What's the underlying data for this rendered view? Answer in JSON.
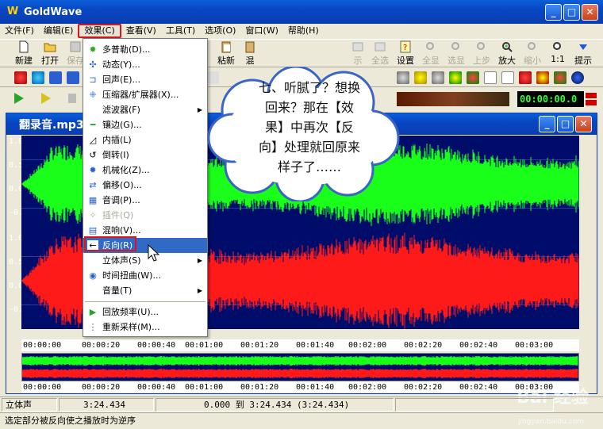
{
  "window": {
    "title": "GoldWave",
    "icon": "W"
  },
  "menubar": [
    "文件(F)",
    "编辑(E)",
    "效果(C)",
    "查看(V)",
    "工具(T)",
    "选项(O)",
    "窗口(W)",
    "帮助(H)"
  ],
  "toolbar1": {
    "new": "新建",
    "open": "打开",
    "save": "保存",
    "paste_new": "粘新",
    "mix": "混",
    "show": "示",
    "select_all": "全选",
    "settings": "设置",
    "all": "全显",
    "selection": "选显",
    "prev": "上步",
    "zoom_in": "放大",
    "zoom_out": "缩小",
    "ratio": "1:1",
    "hint": "提示"
  },
  "time_display": "00:00:00.0",
  "document": {
    "title": "翻录音.mp3"
  },
  "y_labels": [
    "1.0",
    "0.5",
    "0.0",
    "-0.5",
    "1.0",
    "0.5",
    "0.0",
    "-0.5"
  ],
  "ruler_labels": [
    "00:00:00",
    "00:00:20",
    "00:00:40",
    "00:01:00",
    "00:01:20",
    "00:01:40",
    "00:02:00",
    "00:02:20",
    "00:02:40",
    "00:03:00"
  ],
  "effects_menu": [
    {
      "label": "多普勒(D)...",
      "icon": "doppler-icon",
      "disabled": false,
      "submenu": false
    },
    {
      "label": "动态(Y)...",
      "icon": "dynamics-icon",
      "disabled": false,
      "submenu": false
    },
    {
      "label": "回声(E)...",
      "icon": "echo-icon",
      "disabled": false,
      "submenu": false
    },
    {
      "label": "压缩器/扩展器(X)...",
      "icon": "compressor-icon",
      "disabled": false,
      "submenu": false
    },
    {
      "label": "滤波器(F)",
      "icon": "",
      "disabled": false,
      "submenu": true
    },
    {
      "label": "镶边(G)...",
      "icon": "flanger-icon",
      "disabled": false,
      "submenu": false
    },
    {
      "label": "内插(L)",
      "icon": "interpolate-icon",
      "disabled": false,
      "submenu": false
    },
    {
      "label": "倒转(I)",
      "icon": "invert-icon",
      "disabled": false,
      "submenu": false
    },
    {
      "label": "机械化(Z)...",
      "icon": "mechanize-icon",
      "disabled": false,
      "submenu": false
    },
    {
      "label": "偏移(O)...",
      "icon": "offset-icon",
      "disabled": false,
      "submenu": false
    },
    {
      "label": "音调(P)...",
      "icon": "pitch-icon",
      "disabled": false,
      "submenu": false
    },
    {
      "label": "插件(Q)",
      "icon": "plugin-icon",
      "disabled": true,
      "submenu": false
    },
    {
      "label": "混响(V)...",
      "icon": "reverb-icon",
      "disabled": false,
      "submenu": false
    },
    {
      "label": "反向(R)",
      "icon": "reverse-icon",
      "disabled": false,
      "submenu": false
    },
    {
      "label": "立体声(S)",
      "icon": "",
      "disabled": false,
      "submenu": true
    },
    {
      "label": "时间扭曲(W)...",
      "icon": "timewarp-icon",
      "disabled": false,
      "submenu": false
    },
    {
      "label": "音量(T)",
      "icon": "",
      "disabled": false,
      "submenu": true
    },
    {
      "label": "回放频率(U)...",
      "icon": "playback-rate-icon",
      "disabled": false,
      "submenu": false
    },
    {
      "label": "重新采样(M)...",
      "icon": "resample-icon",
      "disabled": false,
      "submenu": false
    }
  ],
  "callout": [
    "七、听腻了？想换",
    "回来？那在【效",
    "果】中再次【反",
    "向】处理就回原来",
    "样子了……"
  ],
  "status": {
    "channel": "立体声",
    "length": "3:24.434",
    "selection": "0.000 到 3:24.434 (3:24.434)",
    "hint": "选定部分被反向使之播放时为逆序"
  },
  "watermark": "Bai 经验",
  "watermark_url": "jingyan.baidu.com",
  "colors": {
    "accent": "#0a3eb0",
    "wave_bg": "#000c6a",
    "left_channel": "#1aff1a",
    "right_channel": "#ff1a1a",
    "highlight": "#316ac5",
    "annotation_red": "#d8161b"
  }
}
